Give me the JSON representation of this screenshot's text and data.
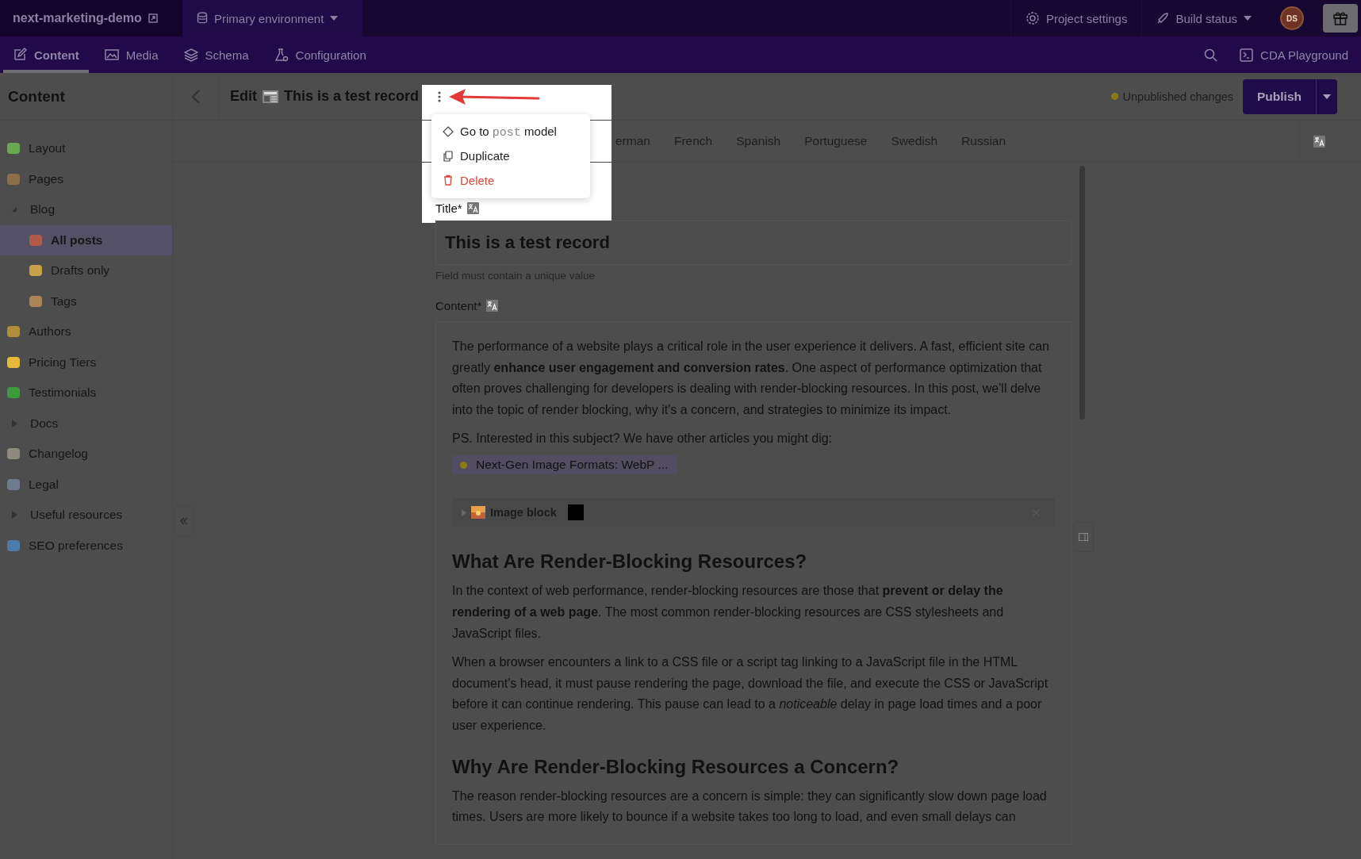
{
  "topbar": {
    "project": "next-marketing-demo",
    "environment": "Primary environment",
    "project_settings": "Project settings",
    "build_status": "Build status",
    "avatar": "DS"
  },
  "nav": {
    "tabs": [
      {
        "label": "Content",
        "selected": true
      },
      {
        "label": "Media",
        "selected": false
      },
      {
        "label": "Schema",
        "selected": false
      },
      {
        "label": "Configuration",
        "selected": false
      }
    ],
    "playground": "CDA Playground"
  },
  "sidebar": {
    "title": "Content",
    "items": [
      {
        "label": "Layout",
        "kind": "link",
        "selected": false
      },
      {
        "label": "Pages",
        "kind": "link",
        "selected": false
      },
      {
        "label": "Blog",
        "kind": "folder",
        "expanded": true,
        "selected": false,
        "children": [
          {
            "label": "All posts",
            "kind": "link",
            "selected": true
          },
          {
            "label": "Drafts only",
            "kind": "link",
            "selected": false
          },
          {
            "label": "Tags",
            "kind": "link",
            "selected": false
          }
        ]
      },
      {
        "label": "Authors",
        "kind": "link",
        "selected": false
      },
      {
        "label": "Pricing Tiers",
        "kind": "link",
        "selected": false
      },
      {
        "label": "Testimonials",
        "kind": "link",
        "selected": false
      },
      {
        "label": "Docs",
        "kind": "folder",
        "expanded": false,
        "selected": false
      },
      {
        "label": "Changelog",
        "kind": "link",
        "selected": false
      },
      {
        "label": "Legal",
        "kind": "link",
        "selected": false
      },
      {
        "label": "Useful resources",
        "kind": "folder",
        "expanded": false,
        "selected": false
      },
      {
        "label": "SEO preferences",
        "kind": "link",
        "selected": false
      }
    ]
  },
  "header": {
    "edit": "Edit",
    "title": "This is a test record",
    "status": "Unpublished changes",
    "publish": "Publish"
  },
  "menu": [
    {
      "kind": "model",
      "before": "Go to",
      "code": "post",
      "after": "model"
    },
    {
      "kind": "copy",
      "before": "Duplicate"
    },
    {
      "kind": "delete",
      "before": "Delete"
    }
  ],
  "locales": [
    "erman",
    "French",
    "Spanish",
    "Portuguese",
    "Swedish",
    "Russian"
  ],
  "fields": {
    "title_label": "Title*",
    "title_value": "This is a test record",
    "title_hint": "Field must contain a unique value",
    "content_label": "Content*"
  },
  "blocks": [
    {
      "kind": "paragraph",
      "text": "The performance of a website plays a critical role in the user experience it delivers. A fast, efficient site can greatly **enhance user engagement and conversion rates**. One aspect of performance optimization that often proves challenging for developers is dealing with render-blocking resources. In this post, we'll delve into the topic of render blocking, why it's a concern, and strategies to minimize its impact."
    },
    {
      "kind": "paragraph",
      "text": "PS. Interested in this subject? We have other articles you might dig:"
    },
    {
      "kind": "link",
      "text": "Next-Gen Image Formats: WebP ..."
    },
    {
      "kind": "image_block",
      "text": "Image block"
    },
    {
      "kind": "heading",
      "text": "What Are Render-Blocking Resources?"
    },
    {
      "kind": "paragraph",
      "text": "In the context of web performance, render-blocking resources are those that **prevent or delay the rendering of a web page**. The most common render-blocking resources are CSS stylesheets and JavaScript files."
    },
    {
      "kind": "paragraph",
      "text": "When a browser encounters a link to a CSS file or a script tag linking to a JavaScript file in the HTML document's head, it must pause rendering the page, download the file, and execute the CSS or JavaScript before it can continue rendering. This pause can lead to a *noticeable* delay in page load times and a poor user experience."
    },
    {
      "kind": "heading",
      "text": "Why Are Render-Blocking Resources a Concern?"
    },
    {
      "kind": "paragraph",
      "text": "The reason render-blocking resources are a concern is simple: they can significantly slow down page load times. Users are more likely to bounce if a website takes too long to load, and even small delays can"
    }
  ]
}
